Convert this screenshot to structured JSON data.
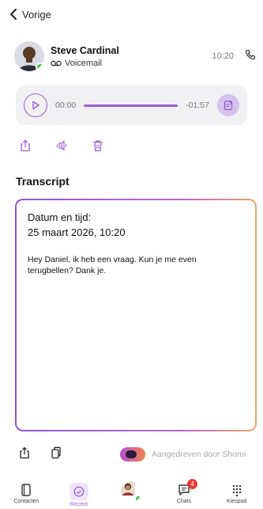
{
  "nav": {
    "back_label": "Vorige"
  },
  "contact": {
    "name": "Steve Cardinal",
    "type_label": "Voicemail",
    "time": "10:20",
    "presence_color": "#3fc24a"
  },
  "player": {
    "current_time": "00:00",
    "remaining_time": "-01:57",
    "progress": 0,
    "accent_color": "#9b5fd3"
  },
  "actions": {
    "icons": [
      "share-icon",
      "speaker-icon",
      "trash-icon"
    ]
  },
  "transcript": {
    "title": "Transcript",
    "date_label": "Datum en tijd:",
    "date_value": "25 maart 2026, 10:20",
    "text": "Hey Daniel, ik heb een vraag. Kun je me even terugbellen? Dank je."
  },
  "footer": {
    "powered_by": "Aangedreven door Shomi"
  },
  "tabbar": {
    "tabs": [
      {
        "label": "Contacten",
        "icon": "contacts-icon"
      },
      {
        "label": "Recent",
        "icon": "recent-icon",
        "active": true
      },
      {
        "label": "",
        "icon": "profile-avatar"
      },
      {
        "label": "Chats",
        "icon": "chats-icon",
        "badge": "4"
      },
      {
        "label": "Kiespad",
        "icon": "keypad-icon"
      }
    ]
  }
}
